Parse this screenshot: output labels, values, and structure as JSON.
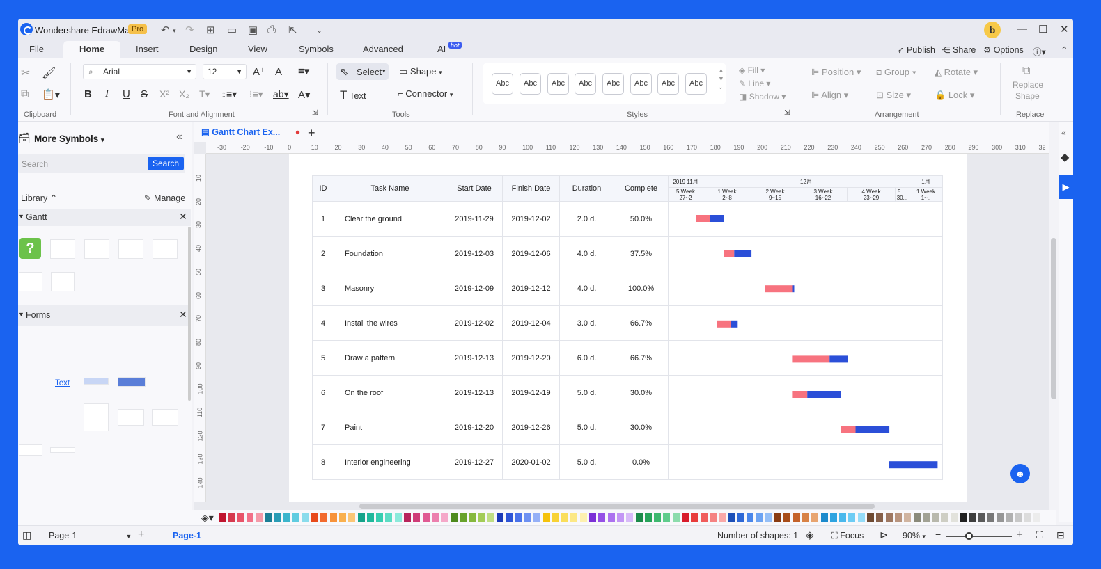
{
  "app": {
    "title": "Wondershare EdrawMax",
    "badge": "Pro",
    "avatar_letter": "b"
  },
  "menu_tabs": [
    "File",
    "Home",
    "Insert",
    "Design",
    "View",
    "Symbols",
    "Advanced",
    "AI"
  ],
  "ai_badge": "hot",
  "right_actions": {
    "publish": "Publish",
    "share": "Share",
    "options": "Options"
  },
  "ribbon": {
    "clipboard_label": "Clipboard",
    "font": "Arial",
    "size": "12",
    "font_label": "Font and Alignment",
    "select": "Select",
    "shape": "Shape",
    "text": "Text",
    "connector": "Connector",
    "tools_label": "Tools",
    "style_sample": "Abc",
    "fill": "Fill",
    "line": "Line",
    "shadow": "Shadow",
    "styles_label": "Styles",
    "position": "Position",
    "group": "Group",
    "rotate": "Rotate",
    "align": "Align",
    "size_label": "Size",
    "lock": "Lock",
    "arrangement_label": "Arrangement",
    "replace_shape_1": "Replace",
    "replace_shape_2": "Shape",
    "replace_label": "Replace"
  },
  "left_panel": {
    "title": "More Symbols",
    "search_placeholder": "Search",
    "search_button": "Search",
    "library": "Library",
    "manage": "Manage",
    "gantt": "Gantt",
    "forms": "Forms",
    "form_text": "Text"
  },
  "doc_tab": "Gantt Chart Ex...",
  "ruler_h": [
    "-30",
    "-20",
    "-10",
    "0",
    "10",
    "20",
    "30",
    "40",
    "50",
    "60",
    "70",
    "80",
    "90",
    "100",
    "110",
    "120",
    "130",
    "140",
    "150",
    "160",
    "170",
    "180",
    "190",
    "200",
    "210",
    "220",
    "230",
    "240",
    "250",
    "260",
    "270",
    "280",
    "290",
    "300",
    "310",
    "32"
  ],
  "ruler_v": [
    "10",
    "20",
    "30",
    "40",
    "50",
    "60",
    "70",
    "80",
    "90",
    "100",
    "110",
    "120",
    "130",
    "140"
  ],
  "gantt": {
    "headers": [
      "ID",
      "Task Name",
      "Start Date",
      "Finish Date",
      "Duration",
      "Complete"
    ],
    "months": [
      "2019 11月",
      "12月",
      "1月"
    ],
    "weeks": [
      {
        "w": "5 Week",
        "d": "27~2"
      },
      {
        "w": "1 Week",
        "d": "2~8"
      },
      {
        "w": "2 Week",
        "d": "9~15"
      },
      {
        "w": "3 Week",
        "d": "16~22"
      },
      {
        "w": "4 Week",
        "d": "23~29"
      },
      {
        "w": "5 ...",
        "d": "30..."
      },
      {
        "w": "1 Week",
        "d": "1~.."
      }
    ],
    "rows": [
      {
        "id": "1",
        "name": "Clear the ground",
        "start": "2019-11-29",
        "finish": "2019-12-02",
        "duration": "2.0 d.",
        "complete": "50.0%",
        "fraction": 0.5
      },
      {
        "id": "2",
        "name": "Foundation",
        "start": "2019-12-03",
        "finish": "2019-12-06",
        "duration": "4.0 d.",
        "complete": "37.5%",
        "fraction": 0.375
      },
      {
        "id": "3",
        "name": "Masonry",
        "start": "2019-12-09",
        "finish": "2019-12-12",
        "duration": "4.0 d.",
        "complete": "100.0%",
        "fraction": 1.0
      },
      {
        "id": "4",
        "name": "Install the wires",
        "start": "2019-12-02",
        "finish": "2019-12-04",
        "duration": "3.0 d.",
        "complete": "66.7%",
        "fraction": 0.667
      },
      {
        "id": "5",
        "name": "Draw a pattern",
        "start": "2019-12-13",
        "finish": "2019-12-20",
        "duration": "6.0 d.",
        "complete": "66.7%",
        "fraction": 0.667
      },
      {
        "id": "6",
        "name": "On the roof",
        "start": "2019-12-13",
        "finish": "2019-12-19",
        "duration": "5.0 d.",
        "complete": "30.0%",
        "fraction": 0.3
      },
      {
        "id": "7",
        "name": "Paint",
        "start": "2019-12-20",
        "finish": "2019-12-26",
        "duration": "5.0 d.",
        "complete": "30.0%",
        "fraction": 0.3
      },
      {
        "id": "8",
        "name": "Interior engineering",
        "start": "2019-12-27",
        "finish": "2020-01-02",
        "duration": "5.0 d.",
        "complete": "0.0%",
        "fraction": 0.0
      }
    ],
    "timeline_start": "2019-11-27",
    "done_color": "#f7737f",
    "todo_color": "#2b4fd8"
  },
  "swatches": [
    "#c0152f",
    "#d63a4f",
    "#e8546a",
    "#f27189",
    "#f59aa9",
    "#1c7f96",
    "#2a9cb5",
    "#3cb5cc",
    "#60cce0",
    "#8adcec",
    "#e84a1c",
    "#f26a2e",
    "#f7923a",
    "#f9b04e",
    "#fbc676",
    "#15a38a",
    "#20b89c",
    "#36cdb0",
    "#5cdcc4",
    "#8ceadb",
    "#b8245c",
    "#cf3c78",
    "#e05a93",
    "#ec7fae",
    "#f5a8c9",
    "#4e8a1e",
    "#68a22c",
    "#86b83e",
    "#a3cc58",
    "#c0de84",
    "#1c3ab8",
    "#2e54d6",
    "#4a72ea",
    "#6d90f2",
    "#95b0f7",
    "#f5c20c",
    "#f8d236",
    "#fade5c",
    "#fce886",
    "#fdf0b0",
    "#7b2fd6",
    "#9550e6",
    "#ac72ef",
    "#c396f5",
    "#d8baf9",
    "#1c8a4a",
    "#27a35a",
    "#3db86f",
    "#5fcc8c",
    "#8cdcac",
    "#d81c2c",
    "#e83c3c",
    "#f05c5c",
    "#f58282",
    "#f9a8a8",
    "#1c4fb8",
    "#2e68d6",
    "#4a86ea",
    "#6da3f2",
    "#95bff7",
    "#8a3c12",
    "#a84c18",
    "#c4622a",
    "#d88246",
    "#e8a470",
    "#1c8acc",
    "#2ea3e0",
    "#4ab8ec",
    "#6dccf4",
    "#95dcf8",
    "#6e4a32",
    "#86604a",
    "#9e7862",
    "#b8947e",
    "#d0b4a0",
    "#8a8a7a",
    "#a2a294",
    "#b8b8ac",
    "#cecec4",
    "#e2e2dc",
    "#222222",
    "#3e3e3e",
    "#5a5a5a",
    "#787878",
    "#969696",
    "#b0b0b0",
    "#c8c8c8",
    "#dcdcdc",
    "#ececec"
  ],
  "status": {
    "page_select": "Page-1",
    "page_tab": "Page-1",
    "shapes": "Number of shapes: 1",
    "focus": "Focus",
    "zoom": "90%",
    "zoom_fraction": 0.35
  }
}
